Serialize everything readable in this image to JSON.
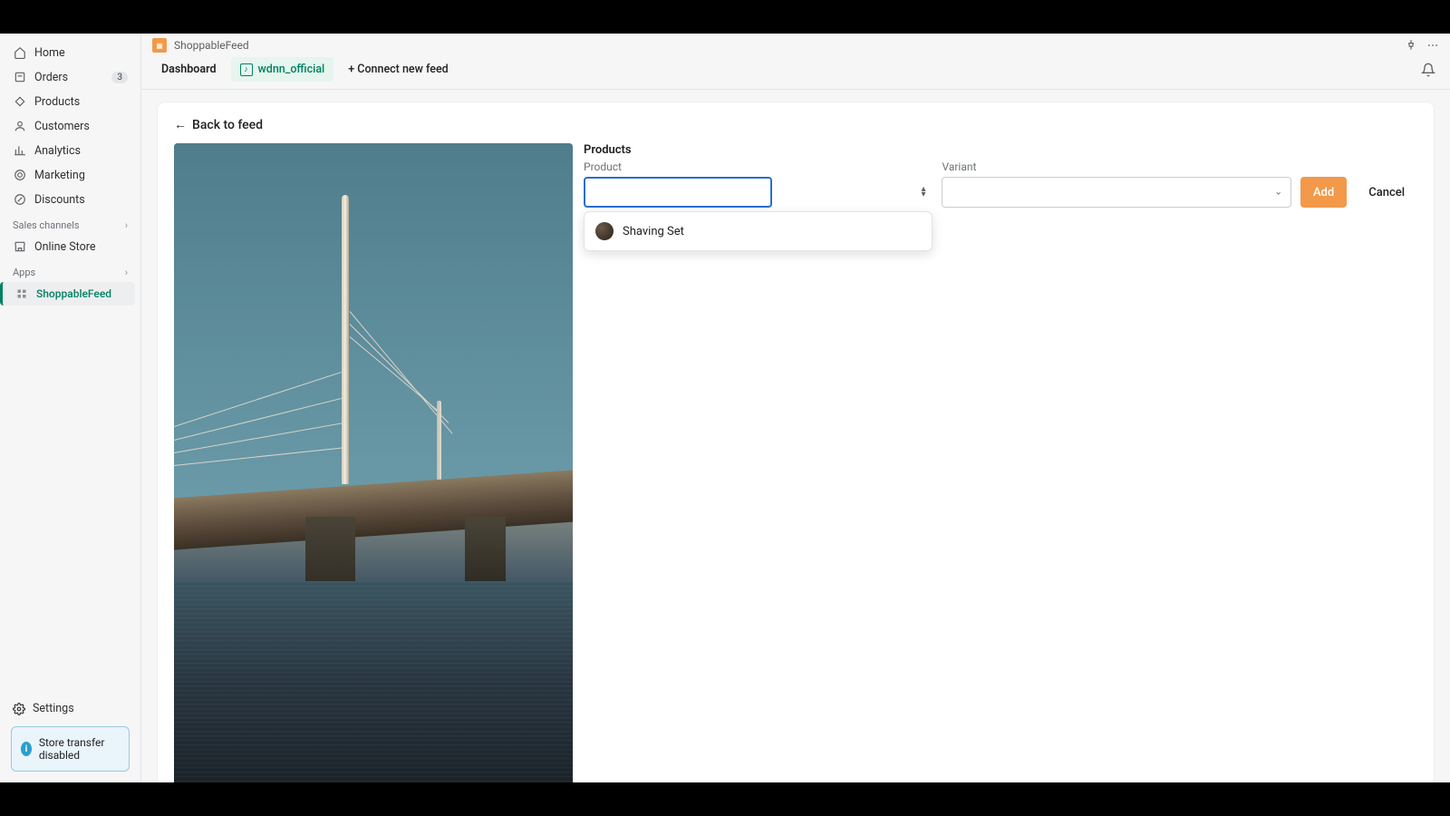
{
  "sidebar": {
    "items": [
      {
        "label": "Home"
      },
      {
        "label": "Orders",
        "badge": "3"
      },
      {
        "label": "Products"
      },
      {
        "label": "Customers"
      },
      {
        "label": "Analytics"
      },
      {
        "label": "Marketing"
      },
      {
        "label": "Discounts"
      }
    ],
    "sales_channels_label": "Sales channels",
    "online_store_label": "Online Store",
    "apps_label": "Apps",
    "app_item_label": "ShoppableFeed",
    "settings_label": "Settings",
    "store_transfer_label": "Store transfer disabled"
  },
  "topbar": {
    "app_name": "ShoppableFeed"
  },
  "tabs": {
    "dashboard": "Dashboard",
    "feed_name": "wdnn_official",
    "connect": "+ Connect new feed"
  },
  "content": {
    "back_label": "Back to feed",
    "products_heading": "Products",
    "product_label": "Product",
    "variant_label": "Variant",
    "add_label": "Add",
    "cancel_label": "Cancel",
    "product_input_value": "",
    "variant_value": "",
    "dropdown": {
      "items": [
        {
          "label": "Shaving Set"
        }
      ]
    }
  }
}
